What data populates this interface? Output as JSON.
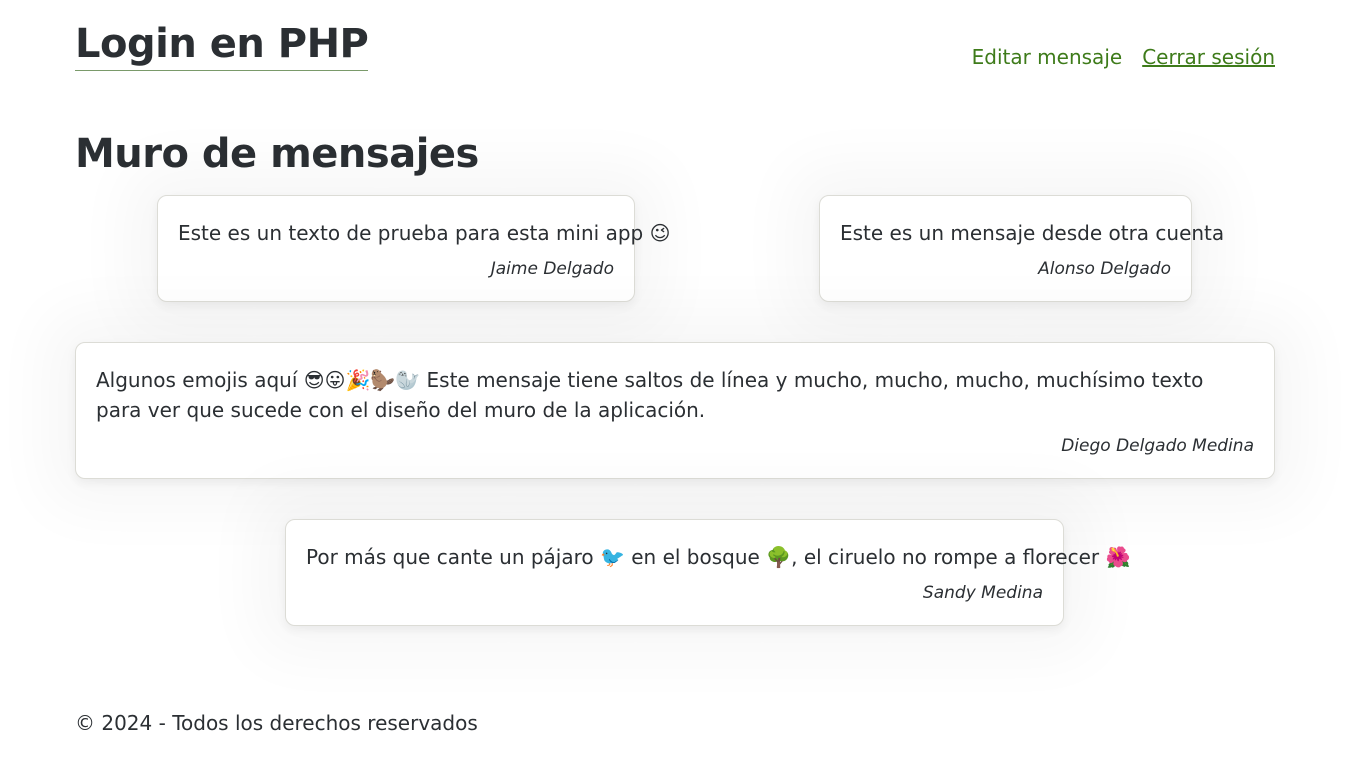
{
  "header": {
    "title": "Login en PHP",
    "nav": {
      "edit_message": "Editar mensaje",
      "logout": "Cerrar sesión"
    }
  },
  "wall": {
    "title": "Muro de mensajes",
    "messages": [
      {
        "text": "Este es un texto de prueba para esta mini app 😉",
        "author": "Jaime Delgado"
      },
      {
        "text": "Este es un mensaje desde otra cuenta",
        "author": "Alonso Delgado"
      },
      {
        "text": "Algunos emojis aquí 😎😛🎉🦫🦭 Este mensaje tiene saltos de línea y mucho, mucho, mucho, muchísimo texto para ver que sucede con el diseño del muro de la aplicación.",
        "author": "Diego Delgado Medina"
      },
      {
        "text": "Por más que cante un pájaro 🐦 en el bosque 🌳, el ciruelo no rompe a florecer 🌺",
        "author": "Sandy Medina"
      }
    ]
  },
  "footer": {
    "text": "© 2024 - Todos los derechos reservados"
  },
  "colors": {
    "link": "#3e7b1a",
    "text": "#2b2f33",
    "card_border": "#dcdcd6"
  }
}
